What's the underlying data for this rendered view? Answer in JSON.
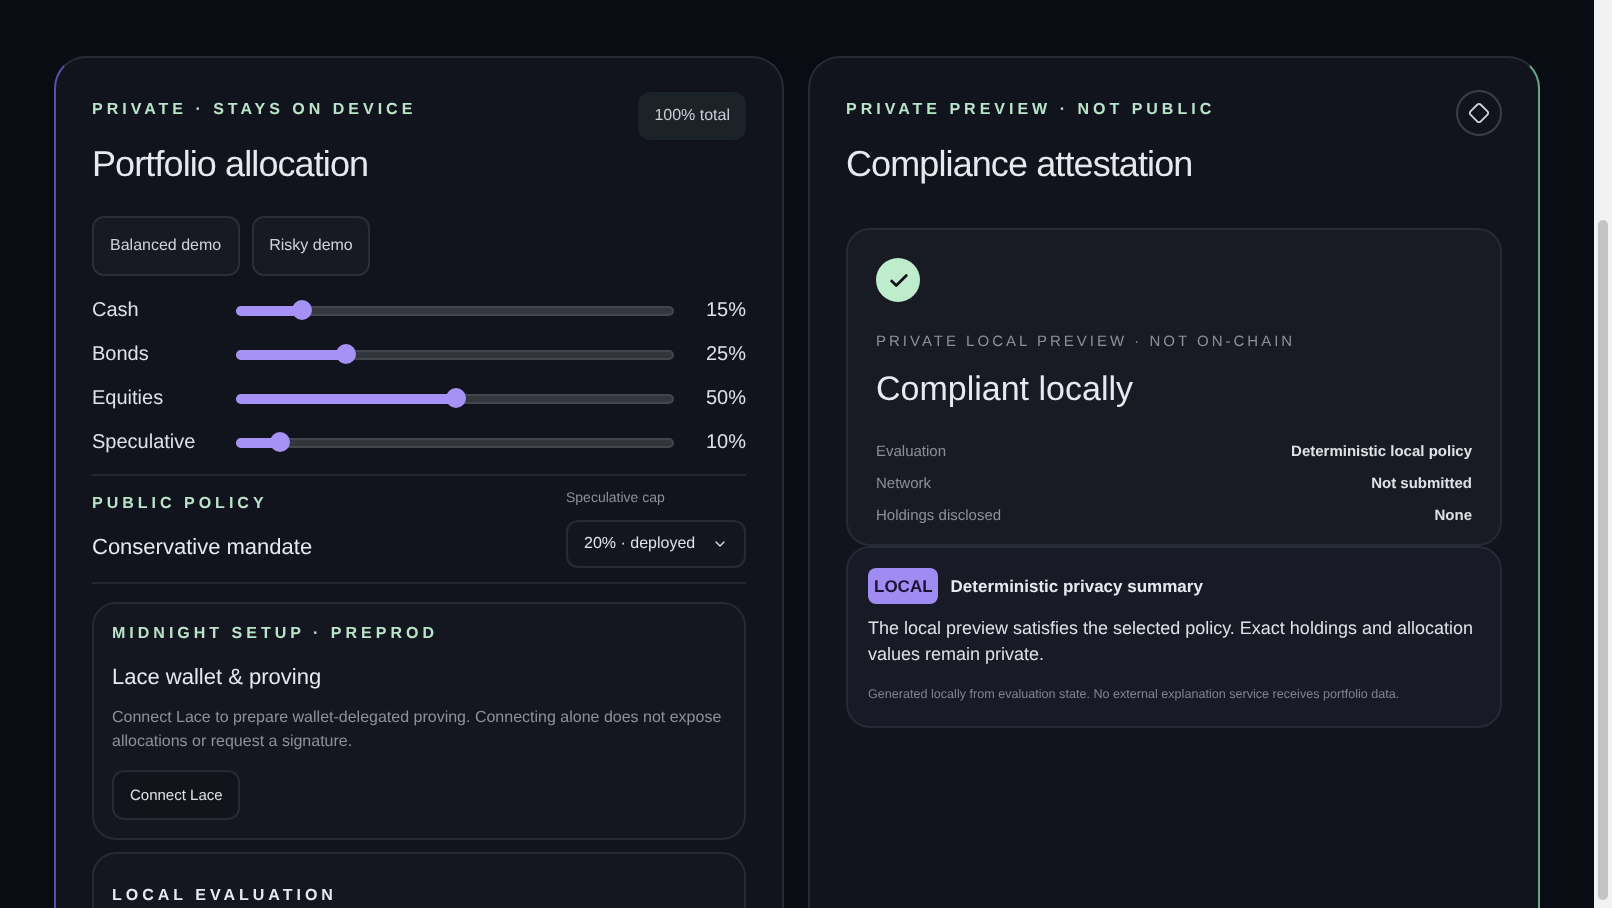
{
  "allocation": {
    "eyebrow": "PRIVATE · STAYS ON DEVICE",
    "title": "Portfolio allocation",
    "total_badge": "100% total",
    "presets": [
      "Balanced demo",
      "Risky demo"
    ],
    "assets": [
      {
        "name": "Cash",
        "level": 0.15,
        "reading": "15%"
      },
      {
        "name": "Bonds",
        "level": 0.25,
        "reading": "25%"
      },
      {
        "name": "Equities",
        "level": 0.5,
        "reading": "50%"
      },
      {
        "name": "Speculative",
        "level": 0.1,
        "reading": "10%"
      }
    ]
  },
  "policy": {
    "eyebrow": "PUBLIC POLICY",
    "name": "Conservative mandate",
    "cap_label": "Speculative cap",
    "cap_value": "20% · deployed"
  },
  "setup": {
    "eyebrow": "MIDNIGHT SETUP · PREPROD",
    "title": "Lace wallet & proving",
    "description": "Connect Lace to prepare wallet-delegated proving. Connecting alone does not expose allocations or request a signature.",
    "button": "Connect Lace"
  },
  "evaluation": {
    "eyebrow": "LOCAL EVALUATION"
  },
  "attestation": {
    "eyebrow": "PRIVATE PREVIEW · NOT PUBLIC",
    "title": "Compliance attestation",
    "result": {
      "compliant": true,
      "eyebrow": "PRIVATE LOCAL PREVIEW · NOT ON-CHAIN",
      "title": "Compliant locally",
      "rows": [
        {
          "label": "Evaluation",
          "value": "Deterministic local policy"
        },
        {
          "label": "Network",
          "value": "Not submitted"
        },
        {
          "label": "Holdings disclosed",
          "value": "None"
        }
      ]
    },
    "summary": {
      "badge": "LOCAL",
      "title": "Deterministic privacy summary",
      "body": "The local preview satisfies the selected policy. Exact holdings and allocation values remain private.",
      "footnote": "Generated locally from evaluation state. No external explanation service receives portfolio data."
    }
  }
}
